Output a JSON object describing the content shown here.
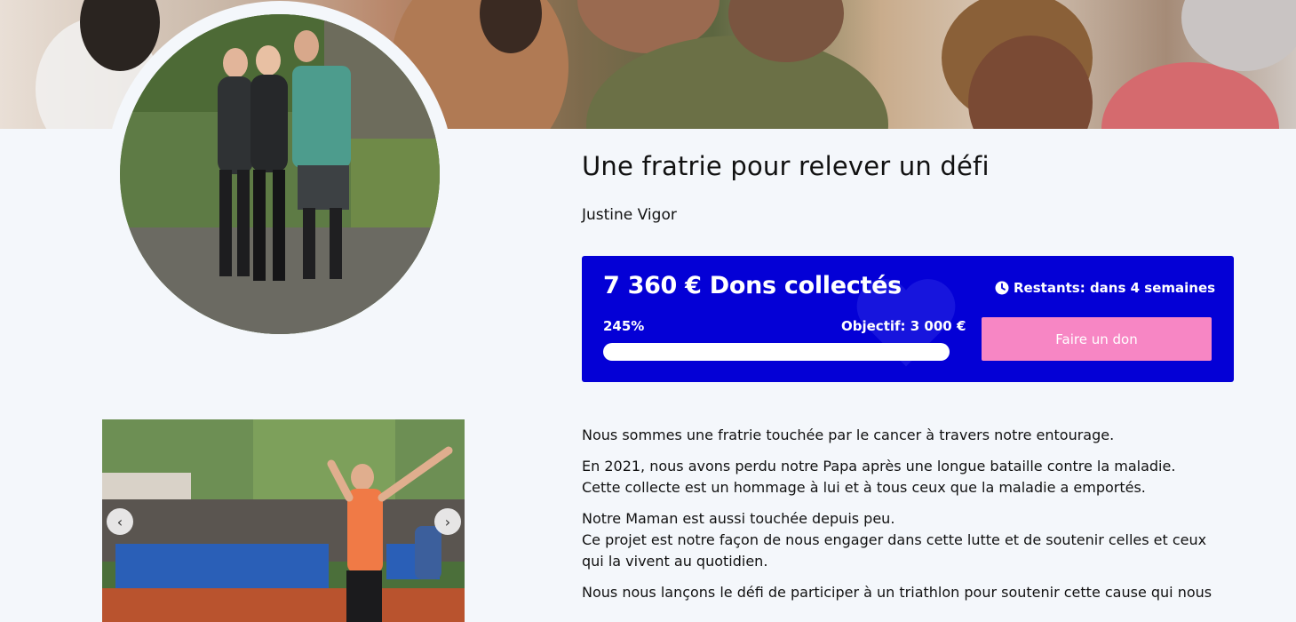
{
  "campaign": {
    "title": "Une fratrie pour relever un défi",
    "author": "Justine Vigor"
  },
  "donation": {
    "amount_label": "7 360 € Dons collectés",
    "percent_label": "245%",
    "goal_label": "Objectif: 3 000 €",
    "progress_fraction": 1.0,
    "remaining_label": "Restants: dans 4 semaines",
    "donate_button": "Faire un don",
    "card_color": "#0400d6",
    "button_color": "#f786c4"
  },
  "carousel": {
    "prev_icon": "chevron-left-icon",
    "next_icon": "chevron-right-icon"
  },
  "description": {
    "paragraphs": [
      [
        "Nous sommes une fratrie touchée par le cancer à travers notre entourage."
      ],
      [
        "En 2021, nous avons perdu notre Papa après une longue bataille contre la maladie.",
        "Cette collecte est un hommage à lui et à tous ceux que la maladie a emportés."
      ],
      [
        "Notre Maman est aussi touchée depuis peu.",
        "Ce projet est notre façon de nous engager dans cette lutte et de soutenir celles et ceux qui la vivent au quotidien."
      ],
      [
        "Nous nous lançons le défi de participer à un triathlon pour soutenir cette cause qui nous"
      ]
    ]
  }
}
